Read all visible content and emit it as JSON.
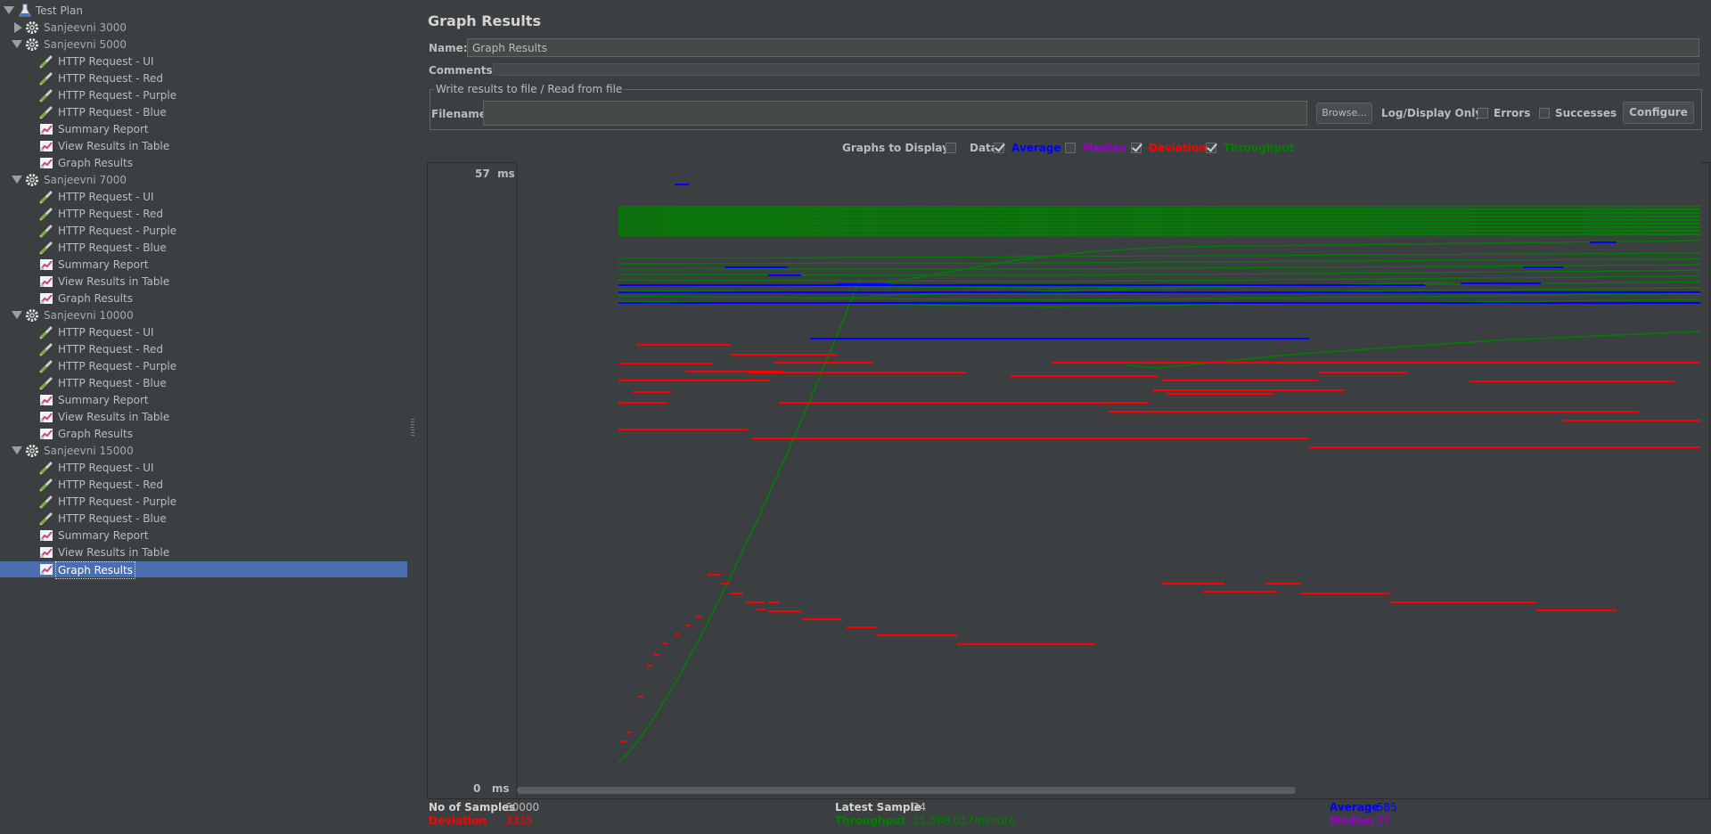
{
  "tree": [
    {
      "label": "Test Plan",
      "icon": "flask-icon",
      "level": 0,
      "expanded": true
    },
    {
      "label": "Sanjeevni 3000",
      "icon": "gear-icon",
      "level": 1,
      "expanded": false,
      "muted": true
    },
    {
      "label": "Sanjeevni 5000",
      "icon": "gear-icon",
      "level": 1,
      "expanded": true,
      "muted": true
    },
    {
      "label": "HTTP Request - UI",
      "icon": "pipette-icon",
      "level": 2
    },
    {
      "label": "HTTP Request - Red",
      "icon": "pipette-icon",
      "level": 2
    },
    {
      "label": "HTTP Request - Purple",
      "icon": "pipette-icon",
      "level": 2
    },
    {
      "label": "HTTP Request - Blue",
      "icon": "pipette-icon",
      "level": 2
    },
    {
      "label": "Summary Report",
      "icon": "chart-icon",
      "level": 2
    },
    {
      "label": "View Results in Table",
      "icon": "chart-icon",
      "level": 2
    },
    {
      "label": "Graph Results",
      "icon": "chart-icon",
      "level": 2
    },
    {
      "label": "Sanjeevni 7000",
      "icon": "gear-icon",
      "level": 1,
      "expanded": true,
      "muted": true
    },
    {
      "label": "HTTP Request - UI",
      "icon": "pipette-icon",
      "level": 2
    },
    {
      "label": "HTTP Request - Red",
      "icon": "pipette-icon",
      "level": 2
    },
    {
      "label": "HTTP Request - Purple",
      "icon": "pipette-icon",
      "level": 2
    },
    {
      "label": "HTTP Request - Blue",
      "icon": "pipette-icon",
      "level": 2
    },
    {
      "label": "Summary Report",
      "icon": "chart-icon",
      "level": 2
    },
    {
      "label": "View Results in Table",
      "icon": "chart-icon",
      "level": 2
    },
    {
      "label": "Graph Results",
      "icon": "chart-icon",
      "level": 2
    },
    {
      "label": "Sanjeevni 10000",
      "icon": "gear-icon",
      "level": 1,
      "expanded": true,
      "muted": true
    },
    {
      "label": "HTTP Request - UI",
      "icon": "pipette-icon",
      "level": 2
    },
    {
      "label": "HTTP Request - Red",
      "icon": "pipette-icon",
      "level": 2
    },
    {
      "label": "HTTP Request - Purple",
      "icon": "pipette-icon",
      "level": 2
    },
    {
      "label": "HTTP Request - Blue",
      "icon": "pipette-icon",
      "level": 2
    },
    {
      "label": "Summary Report",
      "icon": "chart-icon",
      "level": 2
    },
    {
      "label": "View Results in Table",
      "icon": "chart-icon",
      "level": 2
    },
    {
      "label": "Graph Results",
      "icon": "chart-icon",
      "level": 2
    },
    {
      "label": "Sanjeevni 15000",
      "icon": "gear-icon",
      "level": 1,
      "expanded": true,
      "muted": true
    },
    {
      "label": "HTTP Request - UI",
      "icon": "pipette-icon",
      "level": 2
    },
    {
      "label": "HTTP Request - Red",
      "icon": "pipette-icon",
      "level": 2
    },
    {
      "label": "HTTP Request - Purple",
      "icon": "pipette-icon",
      "level": 2
    },
    {
      "label": "HTTP Request - Blue",
      "icon": "pipette-icon",
      "level": 2
    },
    {
      "label": "Summary Report",
      "icon": "chart-icon",
      "level": 2
    },
    {
      "label": "View Results in Table",
      "icon": "chart-icon",
      "level": 2
    },
    {
      "label": "Graph Results",
      "icon": "chart-icon",
      "level": 2,
      "selected": true
    }
  ],
  "panel": {
    "title": "Graph Results",
    "name_label": "Name:",
    "name_value": "Graph Results",
    "comments_label": "Comments:",
    "file_group_label": "Write results to file / Read from file",
    "filename_label": "Filename",
    "filename_value": "",
    "browse_label": "Browse...",
    "logdisplay_label": "Log/Display Only:",
    "errors_label": "Errors",
    "successes_label": "Successes",
    "configure_label": "Configure",
    "graphs_to_display_label": "Graphs to Display",
    "series_toggles": [
      {
        "label": "Data",
        "checked": false,
        "color": "#bbbbbb"
      },
      {
        "label": "Average",
        "checked": true,
        "color": "#0000ff"
      },
      {
        "label": "Median",
        "checked": false,
        "color": "#9900cc"
      },
      {
        "label": "Deviation",
        "checked": true,
        "color": "#ff0000"
      },
      {
        "label": "Throughput",
        "checked": true,
        "color": "#008000"
      }
    ]
  },
  "chart_data": {
    "type": "line",
    "y_max_label": "57",
    "y_min_label": "0",
    "y_unit": "ms",
    "ylim": [
      0,
      57
    ],
    "series": [
      {
        "name": "Average",
        "color": "#0000ff"
      },
      {
        "name": "Deviation",
        "color": "#ff0000"
      },
      {
        "name": "Throughput",
        "color": "#008000"
      }
    ]
  },
  "stats": {
    "samples_label": "No of Samples",
    "samples_value": "60000",
    "latest_label": "Latest Sample",
    "latest_value": "34",
    "average_label": "Average",
    "average_value": "585",
    "deviation_label": "Deviation",
    "deviation_value": "3335",
    "throughput_label": "Throughput",
    "throughput_value": "25,588.017/minute",
    "median_label": "Median",
    "median_value": "37"
  },
  "colors": {
    "average": "#0000ff",
    "deviation": "#ff0000",
    "throughput": "#008000",
    "median": "#9900cc",
    "selection": "#4b6eaf"
  }
}
